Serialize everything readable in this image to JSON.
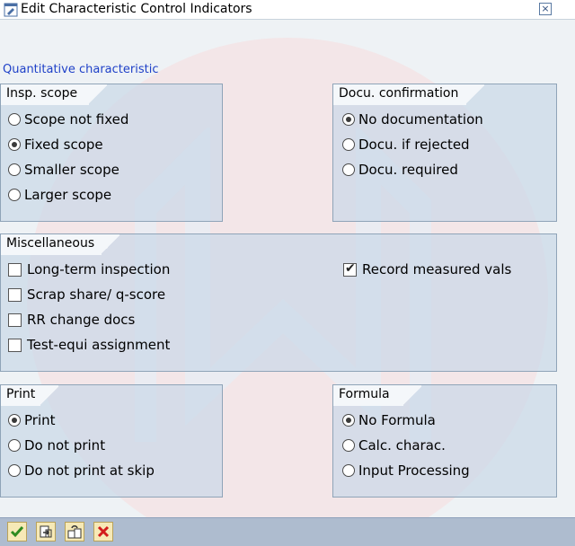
{
  "window": {
    "title": "Edit Characteristic Control Indicators",
    "close_symbol": "×"
  },
  "section": {
    "title": "Quantitative characteristic"
  },
  "groups": {
    "insp_scope": {
      "title": "Insp. scope",
      "options": [
        {
          "label": "Scope not fixed",
          "selected": false
        },
        {
          "label": "Fixed scope",
          "selected": true
        },
        {
          "label": "Smaller scope",
          "selected": false
        },
        {
          "label": "Larger scope",
          "selected": false
        }
      ]
    },
    "docu_confirmation": {
      "title": "Docu. confirmation",
      "options": [
        {
          "label": "No documentation",
          "selected": true
        },
        {
          "label": "Docu. if rejected",
          "selected": false
        },
        {
          "label": "Docu. required",
          "selected": false
        }
      ]
    },
    "miscellaneous": {
      "title": "Miscellaneous",
      "checkboxes": [
        {
          "label": "Long-term inspection",
          "checked": false
        },
        {
          "label": "Scrap share/ q-score",
          "checked": false
        },
        {
          "label": "RR change docs",
          "checked": false
        },
        {
          "label": "Test-equi assignment",
          "checked": false
        },
        {
          "label": "Record measured vals",
          "checked": true
        }
      ]
    },
    "print": {
      "title": "Print",
      "options": [
        {
          "label": "Print",
          "selected": true
        },
        {
          "label": "Do not print",
          "selected": false
        },
        {
          "label": "Do not print at skip",
          "selected": false
        }
      ]
    },
    "formula": {
      "title": "Formula",
      "options": [
        {
          "label": "No Formula",
          "selected": true
        },
        {
          "label": "Calc. charac.",
          "selected": false
        },
        {
          "label": "Input Processing",
          "selected": false
        }
      ]
    }
  },
  "toolbar": {
    "buttons": [
      {
        "name": "confirm-button",
        "icon": "checkmark-icon",
        "color": "#2e8b1f"
      },
      {
        "name": "previous-button",
        "icon": "document-arrow-icon",
        "color": "#333333"
      },
      {
        "name": "next-button",
        "icon": "copy-arrow-icon",
        "color": "#333333"
      },
      {
        "name": "cancel-button",
        "icon": "red-x-icon",
        "color": "#d21c1c"
      }
    ]
  },
  "colors": {
    "section_title": "#1f41c8",
    "group_bg": "#cad8e7",
    "toolbar_bg": "#aebccf"
  }
}
